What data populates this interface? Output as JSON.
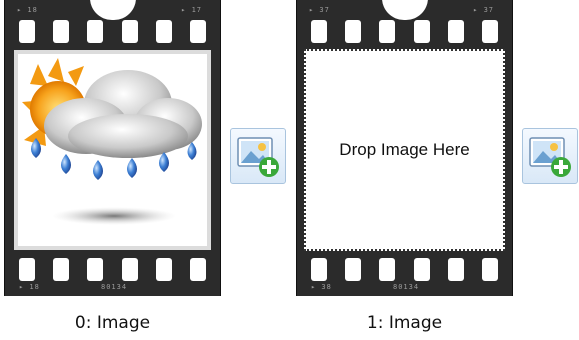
{
  "frames": [
    {
      "caption": "0: Image",
      "has_image": true,
      "image_icon": "weather-rain-cloud-sun-icon"
    },
    {
      "caption": "1: Image",
      "has_image": false,
      "drop_text": "Drop Image Here"
    }
  ],
  "add_image_button_icon": "add-image-icon",
  "colors": {
    "film": "#2b2b2b",
    "button_border": "#a9c4de",
    "plus_green": "#3aa83a"
  }
}
